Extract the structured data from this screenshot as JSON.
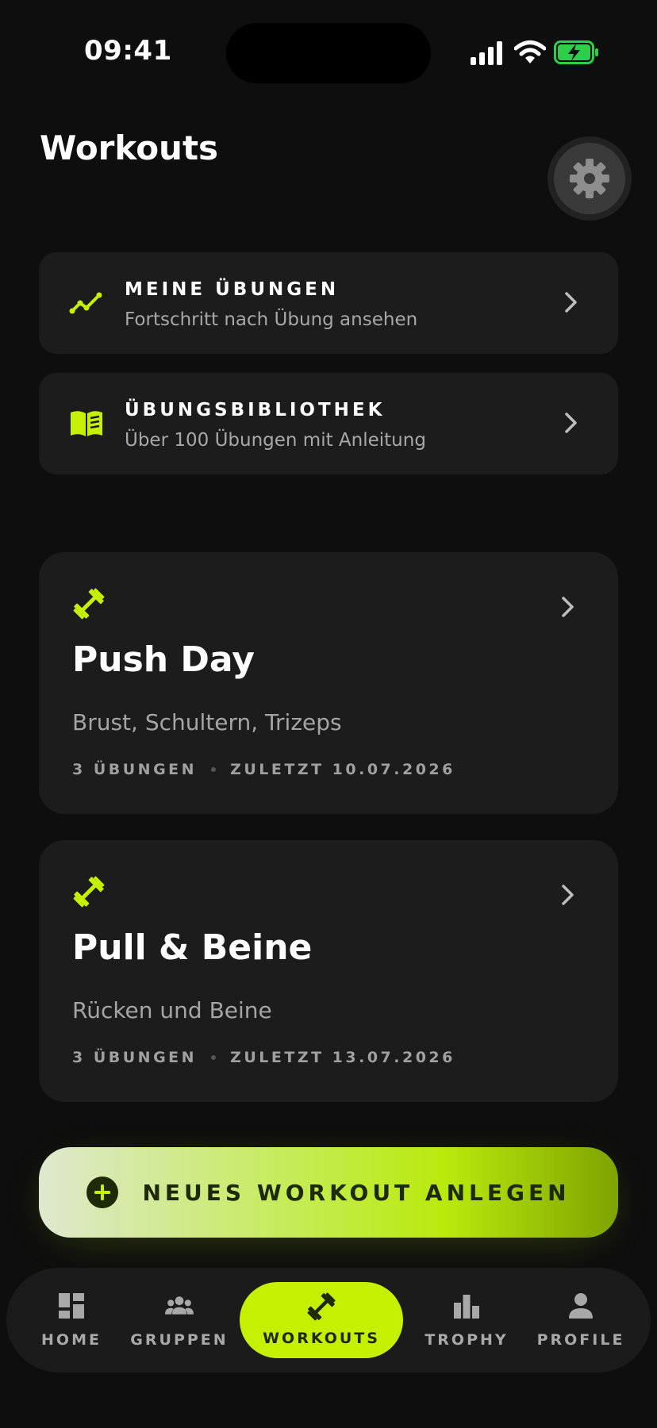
{
  "status_bar": {
    "time": "09:41"
  },
  "header": {
    "title": "Workouts"
  },
  "nav_cards": [
    {
      "title": "MEINE ÜBUNGEN",
      "subtitle": "Fortschritt nach Übung ansehen",
      "icon": "trend-line-icon"
    },
    {
      "title": "ÜBUNGSBIBLIOTHEK",
      "subtitle": "Über 100 Übungen mit Anleitung",
      "icon": "book-icon"
    }
  ],
  "workouts": [
    {
      "name": "Push Day",
      "description": "Brust, Schultern, Trizeps",
      "exercises": "3 ÜBUNGEN",
      "last": "ZULETZT 10.07.2026"
    },
    {
      "name": "Pull & Beine",
      "description": "Rücken und Beine",
      "exercises": "3 ÜBUNGEN",
      "last": "ZULETZT 13.07.2026"
    }
  ],
  "cta": {
    "label": "NEUES WORKOUT ANLEGEN"
  },
  "tabs": [
    {
      "label": "HOME",
      "icon": "grid-icon"
    },
    {
      "label": "GRUPPEN",
      "icon": "group-icon"
    },
    {
      "label": "WORKOUTS",
      "icon": "dumbbell-icon",
      "active": true
    },
    {
      "label": "TROPHY",
      "icon": "bar-chart-icon"
    },
    {
      "label": "PROFILE",
      "icon": "person-icon"
    }
  ],
  "colors": {
    "accent": "#c6f001",
    "card": "#1c1c1c",
    "background": "#0e0e0e",
    "muted_text": "#a8a8a8"
  }
}
